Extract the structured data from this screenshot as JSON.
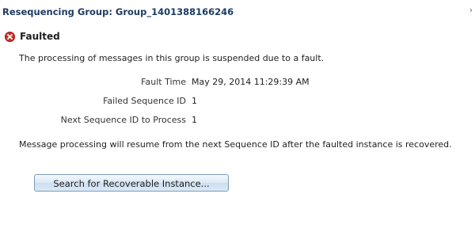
{
  "dialog": {
    "title": "Resequencing Group: Group_1401388166246",
    "close_glyph": "›"
  },
  "status": {
    "icon": "error-x-icon",
    "color": "#c8322c",
    "label": "Faulted"
  },
  "message": "The processing of messages in this group is suspended due to a fault.",
  "details": [
    {
      "label": "Fault Time",
      "value": "May 29, 2014 11:29:39 AM"
    },
    {
      "label": "Failed Sequence ID",
      "value": "1"
    },
    {
      "label": "Next Sequence ID to Process",
      "value": "1"
    }
  ],
  "resume_text": "Message processing will resume from the next Sequence ID after the faulted instance is recovered.",
  "actions": {
    "search_label": "Search for Recoverable Instance..."
  },
  "colors": {
    "title": "#1c3b63",
    "button_border": "#7f9db9"
  }
}
